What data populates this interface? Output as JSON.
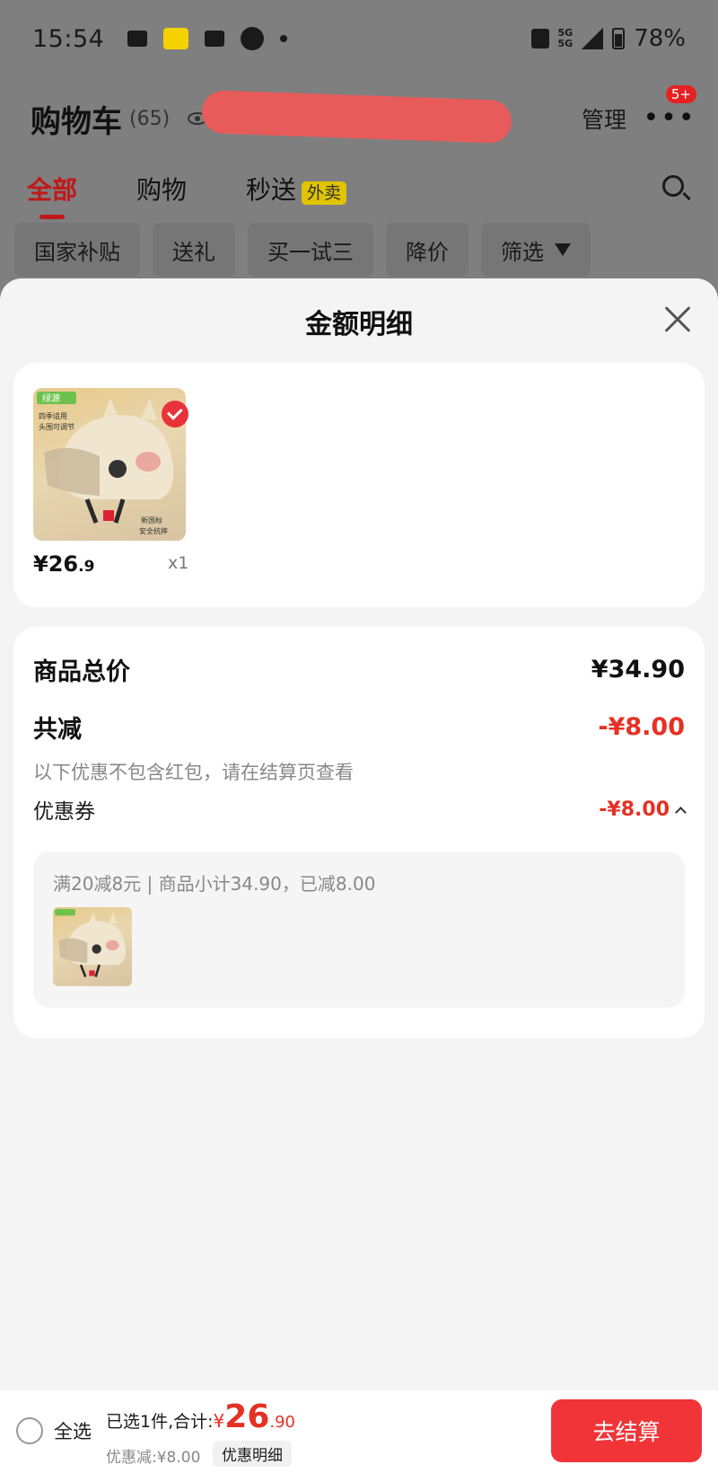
{
  "status_bar": {
    "time": "15:54",
    "notification_icons": [
      "message-icon",
      "app-icon",
      "mail-icon",
      "calendar-icon",
      "dot-icon"
    ],
    "network_top": "5G",
    "network_bottom": "5G",
    "battery": "78%"
  },
  "header": {
    "title": "购物车",
    "count": "(65)",
    "manage_label": "管理",
    "badge": "5+"
  },
  "tabs": [
    {
      "label": "全部",
      "active": true
    },
    {
      "label": "购物",
      "active": false
    },
    {
      "label": "秒送",
      "tag": "外卖",
      "active": false
    }
  ],
  "chips": [
    "国家补贴",
    "送礼",
    "买一试三",
    "降价",
    "筛选"
  ],
  "sheet": {
    "title": "金额明细",
    "product": {
      "price_int": "¥26",
      "price_dec": ".9",
      "quantity": "x1",
      "image_text": {
        "brand": "绿源",
        "line1": "四季适用",
        "line2": "头围可调节",
        "badge1": "新国标",
        "badge2": "安全抗摔"
      }
    },
    "total_label": "商品总价",
    "total_value": "¥34.90",
    "discount_label": "共减",
    "discount_value": "-¥8.00",
    "discount_note": "以下优惠不包含红包，请在结算页查看",
    "coupon_label": "优惠券",
    "coupon_value": "-¥8.00",
    "coupon_desc": "满20减8元 | 商品小计34.90，已减8.00"
  },
  "bottom_bar": {
    "select_all": "全选",
    "summary_label": "已选1件,合计:",
    "total_currency": "¥",
    "total_int": "26",
    "total_dec": ".90",
    "saving": "优惠减:¥8.00",
    "detail_button": "优惠明细",
    "checkout_button": "去结算"
  },
  "colors": {
    "accent_red": "#e53124",
    "checkout_red": "#f13438",
    "overlay_gray": "#7f7f7f"
  }
}
